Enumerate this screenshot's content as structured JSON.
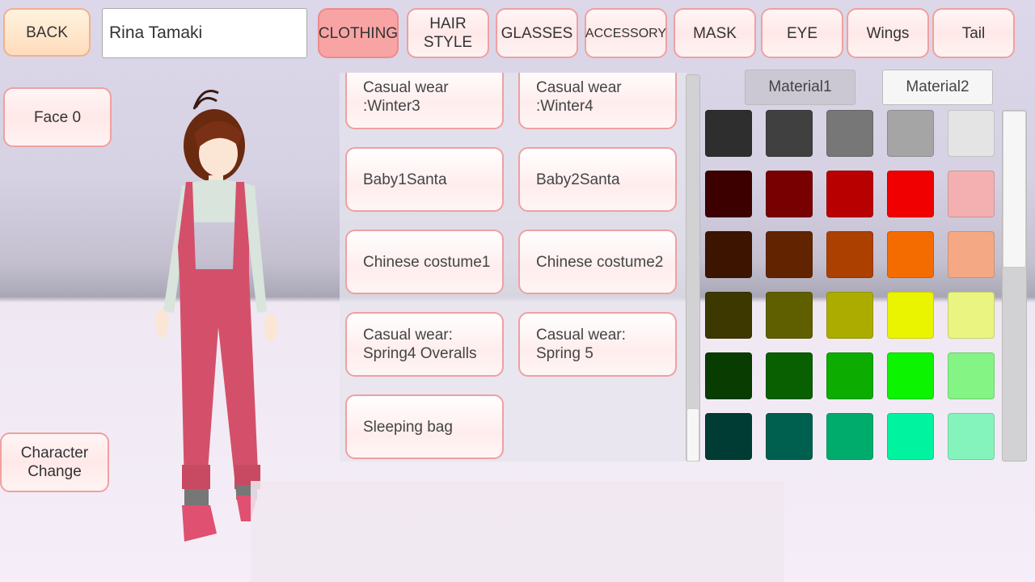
{
  "header": {
    "back_label": "BACK",
    "name_value": "Rina Tamaki",
    "tabs": [
      {
        "label": "CLOTHING",
        "active": true
      },
      {
        "label": "HAIR\nSTYLE"
      },
      {
        "label": "GLASSES"
      },
      {
        "label": "ACCESSORY"
      },
      {
        "label": "MASK"
      },
      {
        "label": "EYE"
      },
      {
        "label": "Wings"
      },
      {
        "label": "Tail"
      }
    ]
  },
  "side": {
    "face_label": "Face 0",
    "character_change_label": "Character\nChange"
  },
  "clothing_items": [
    "Casual wear\n:Winter3",
    "Casual wear\n:Winter4",
    "Baby1Santa",
    "Baby2Santa",
    "Chinese costume1",
    "Chinese costume2",
    "Casual wear:\nSpring4 Overalls",
    "Casual wear:\nSpring 5",
    "Sleeping bag"
  ],
  "materials": {
    "material1": "Material1",
    "material2": "Material2"
  },
  "swatches": [
    [
      "#2e2e2e",
      "#404040",
      "#777777",
      "#a5a5a5",
      "#e4e4e4"
    ],
    [
      "#3d0000",
      "#780000",
      "#b80000",
      "#f00000",
      "#f4b0b0"
    ],
    [
      "#3c1400",
      "#622400",
      "#ac4000",
      "#f46c00",
      "#f4a984"
    ],
    [
      "#3c3800",
      "#5f5f00",
      "#acac00",
      "#eaf400",
      "#eaf480"
    ],
    [
      "#083c00",
      "#086000",
      "#0cac00",
      "#0cf400",
      "#84f484"
    ],
    [
      "#003c34",
      "#006050",
      "#00ac6c",
      "#00f4a0",
      "#84f4bc"
    ]
  ],
  "character_colors": {
    "hair": "#6a2a10",
    "overalls": "#d4506a",
    "shirt": "#d8e4dc",
    "skin": "#fbe6d6"
  }
}
